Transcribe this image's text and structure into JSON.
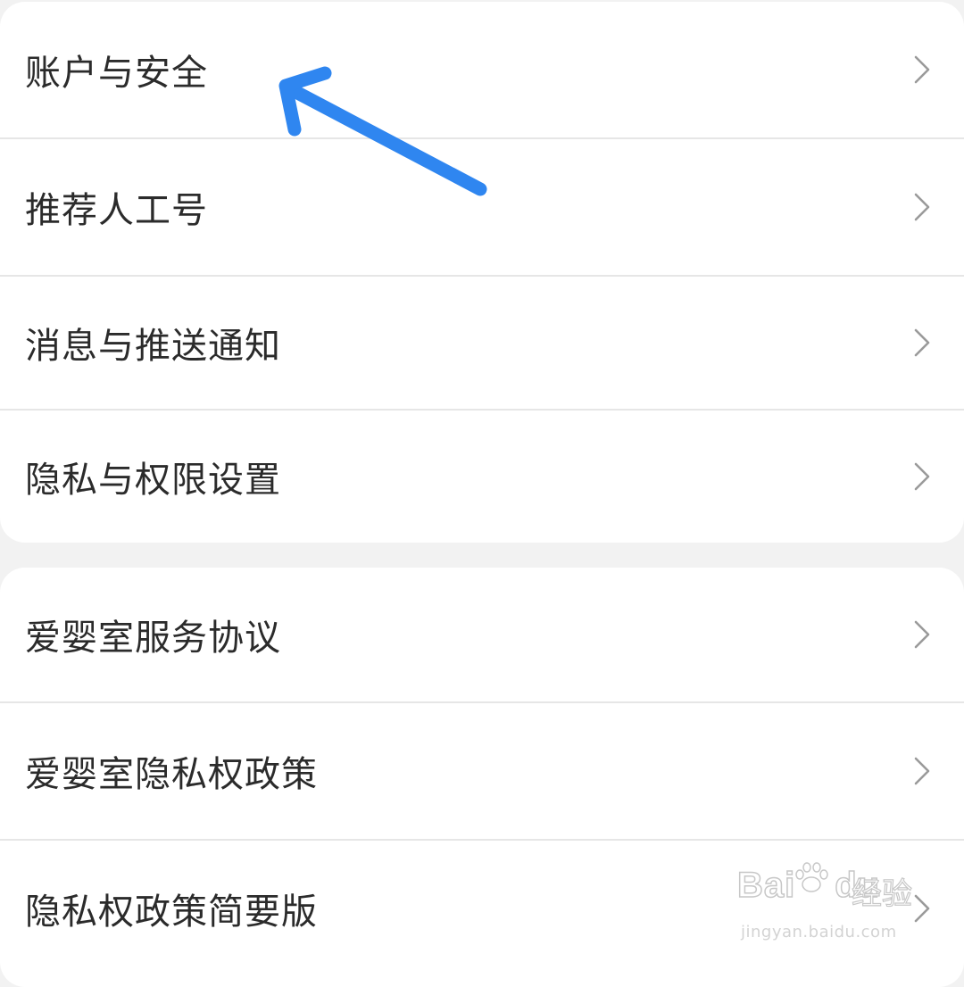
{
  "settings": {
    "group1": [
      {
        "label": "账户与安全"
      },
      {
        "label": "推荐人工号"
      },
      {
        "label": "消息与推送通知"
      },
      {
        "label": "隐私与权限设置"
      }
    ],
    "group2": [
      {
        "label": "爱婴室服务协议"
      },
      {
        "label": "爱婴室隐私权政策"
      },
      {
        "label": "隐私权政策简要版"
      }
    ]
  },
  "icons": {
    "row_chevron": "chevron-right-icon",
    "annotation": "arrow-icon"
  },
  "annotation": {
    "color": "#2f86f0"
  },
  "watermark": {
    "brand": "Bai",
    "brand_tail": "du",
    "sub": "经验",
    "url": "jingyan.baidu.com"
  }
}
